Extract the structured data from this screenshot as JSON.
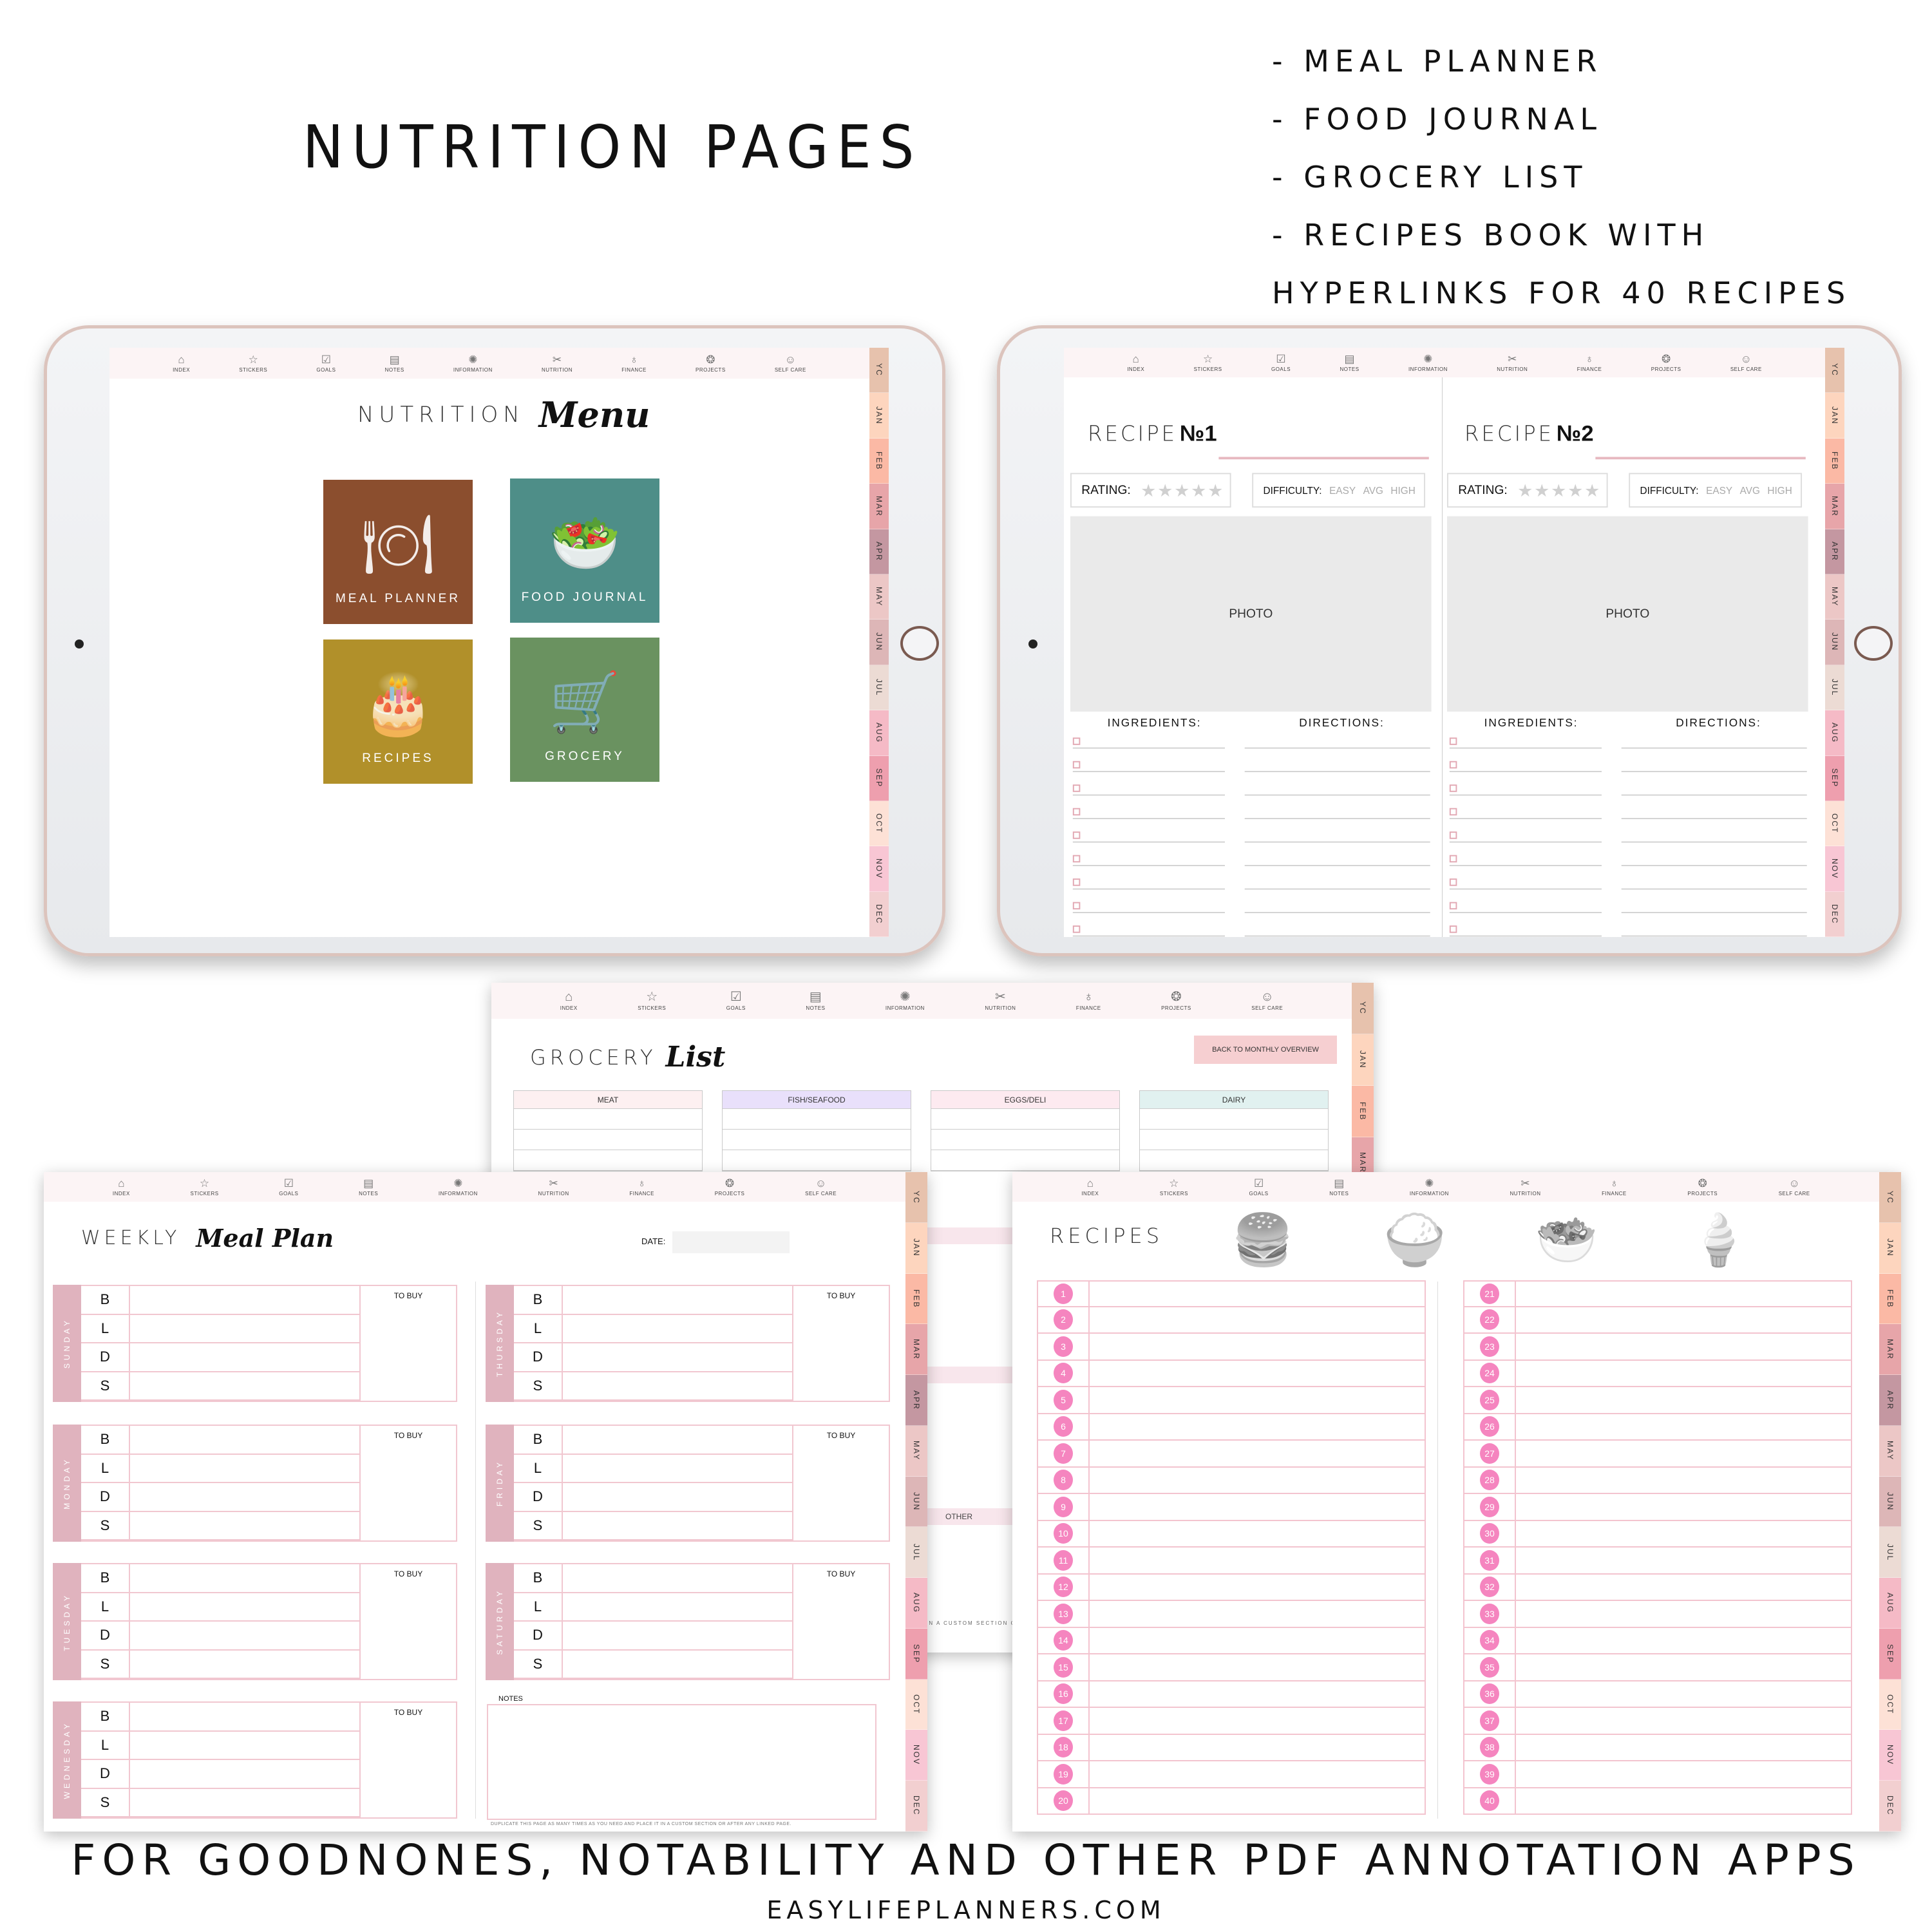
{
  "headline": "NUTRITION PAGES",
  "features": [
    "- MEAL PLANNER",
    "- FOOD JOURNAL",
    "- GROCERY LIST",
    "- RECIPES BOOK WITH",
    "HYPERLINKS FOR 40 RECIPES"
  ],
  "footer": {
    "main": "FOR GOODNONES, NOTABILITY AND OTHER PDF ANNOTATION APPS",
    "url": "EASYLIFEPLANNERS.COM"
  },
  "nav": [
    {
      "label": "INDEX",
      "icon": "home-icon",
      "glyph": "⌂"
    },
    {
      "label": "STICKERS",
      "icon": "star-icon",
      "glyph": "☆"
    },
    {
      "label": "GOALS",
      "icon": "check-icon",
      "glyph": "☑"
    },
    {
      "label": "NOTES",
      "icon": "notepad-icon",
      "glyph": "▤"
    },
    {
      "label": "INFORMATION",
      "icon": "lightbulb-icon",
      "glyph": "✺"
    },
    {
      "label": "NUTRITION",
      "icon": "utensils-icon",
      "glyph": "✂"
    },
    {
      "label": "FINANCE",
      "icon": "money-jar-icon",
      "glyph": "♁"
    },
    {
      "label": "PROJECTS",
      "icon": "yarn-ball-icon",
      "glyph": "❂"
    },
    {
      "label": "SELF CARE",
      "icon": "face-mask-icon",
      "glyph": "☺"
    }
  ],
  "months": [
    {
      "label": "YC",
      "color": "#e7c2ad"
    },
    {
      "label": "JAN",
      "color": "#fdd5be"
    },
    {
      "label": "FEB",
      "color": "#fbb9a5"
    },
    {
      "label": "MAR",
      "color": "#e7a5a9"
    },
    {
      "label": "APR",
      "color": "#c497a1"
    },
    {
      "label": "MAY",
      "color": "#ecc7c6"
    },
    {
      "label": "JUN",
      "color": "#ddb6b7"
    },
    {
      "label": "JUL",
      "color": "#ecdbd4"
    },
    {
      "label": "AUG",
      "color": "#f5bac6"
    },
    {
      "label": "SEP",
      "color": "#ee9fae"
    },
    {
      "label": "OCT",
      "color": "#fde1d6"
    },
    {
      "label": "NOV",
      "color": "#f8c6d4"
    },
    {
      "label": "DEC",
      "color": "#f2cfd0"
    }
  ],
  "menu": {
    "title_thin": "NUTRITION",
    "title_script": "Menu",
    "tiles": [
      {
        "label": "MEAL PLANNER",
        "color": "#8b4e2e",
        "icon": "place-setting-icon",
        "glyph": "🍽"
      },
      {
        "label": "FOOD JOURNAL",
        "color": "#4e8e88",
        "icon": "salad-bowl-icon",
        "glyph": "🥗"
      },
      {
        "label": "RECIPES",
        "color": "#b1902a",
        "icon": "cake-icon",
        "glyph": "🎂"
      },
      {
        "label": "GROCERY",
        "color": "#6a9260",
        "icon": "shopping-cart-icon",
        "glyph": "🛒"
      }
    ]
  },
  "recipe_spread": {
    "pages": [
      {
        "title": "RECIPE",
        "number": "№1"
      },
      {
        "title": "RECIPE",
        "number": "№2"
      }
    ],
    "rating_label": "RATING:",
    "rating_stars": "★★★★★",
    "difficulty_label": "DIFFICULTY:",
    "difficulty_options": [
      "EASY",
      "AVG",
      "HIGH"
    ],
    "photo_label": "PHOTO",
    "ingredients_label": "INGREDIENTS:",
    "directions_label": "DIRECTIONS:"
  },
  "grocery": {
    "title_thin": "GROCERY",
    "title_script": "List",
    "back_button": "BACK TO MONTHLY OVERVIEW",
    "columns": [
      {
        "label": "MEAT",
        "color": "#fdf0f1"
      },
      {
        "label": "FISH/SEAFOOD",
        "color": "#e9e0fb"
      },
      {
        "label": "EGGS/DELI",
        "color": "#fdeaf0"
      },
      {
        "label": "DAIRY",
        "color": "#e1f1f0"
      }
    ],
    "other_label": "OTHER",
    "footnote": "IT IN A CUSTOM SECTION OR"
  },
  "meal_plan": {
    "title_thin": "WEEKLY",
    "title_script": "Meal Plan",
    "date_label": "DATE:",
    "meals": [
      "B",
      "L",
      "D",
      "S"
    ],
    "to_buy": "TO BUY",
    "days": [
      "SUNDAY",
      "MONDAY",
      "TUESDAY",
      "WEDNESDAY",
      "THURSDAY",
      "FRIDAY",
      "SATURDAY"
    ],
    "notes_label": "NOTES",
    "footnote": "DUPLICATE THIS PAGE AS MANY TIMES AS YOU NEED AND PLACE IT IN A CUSTOM SECTION OR AFTER ANY LINKED PAGE."
  },
  "recipes_index": {
    "title": "RECIPES",
    "icons": [
      {
        "name": "burger-icon",
        "glyph": "🍔"
      },
      {
        "name": "rice-bowl-icon",
        "glyph": "🍚"
      },
      {
        "name": "salad-icon",
        "glyph": "🥗"
      },
      {
        "name": "ice-cream-icon",
        "glyph": "🍦"
      }
    ],
    "numbers": [
      "1",
      "2",
      "3",
      "4",
      "5",
      "6",
      "7",
      "8",
      "9",
      "10",
      "11",
      "12",
      "13",
      "14",
      "15",
      "16",
      "17",
      "18",
      "19",
      "20",
      "21",
      "22",
      "23",
      "24",
      "25",
      "26",
      "27",
      "28",
      "29",
      "30",
      "31",
      "32",
      "33",
      "34",
      "35",
      "36",
      "37",
      "38",
      "39",
      "40"
    ]
  }
}
